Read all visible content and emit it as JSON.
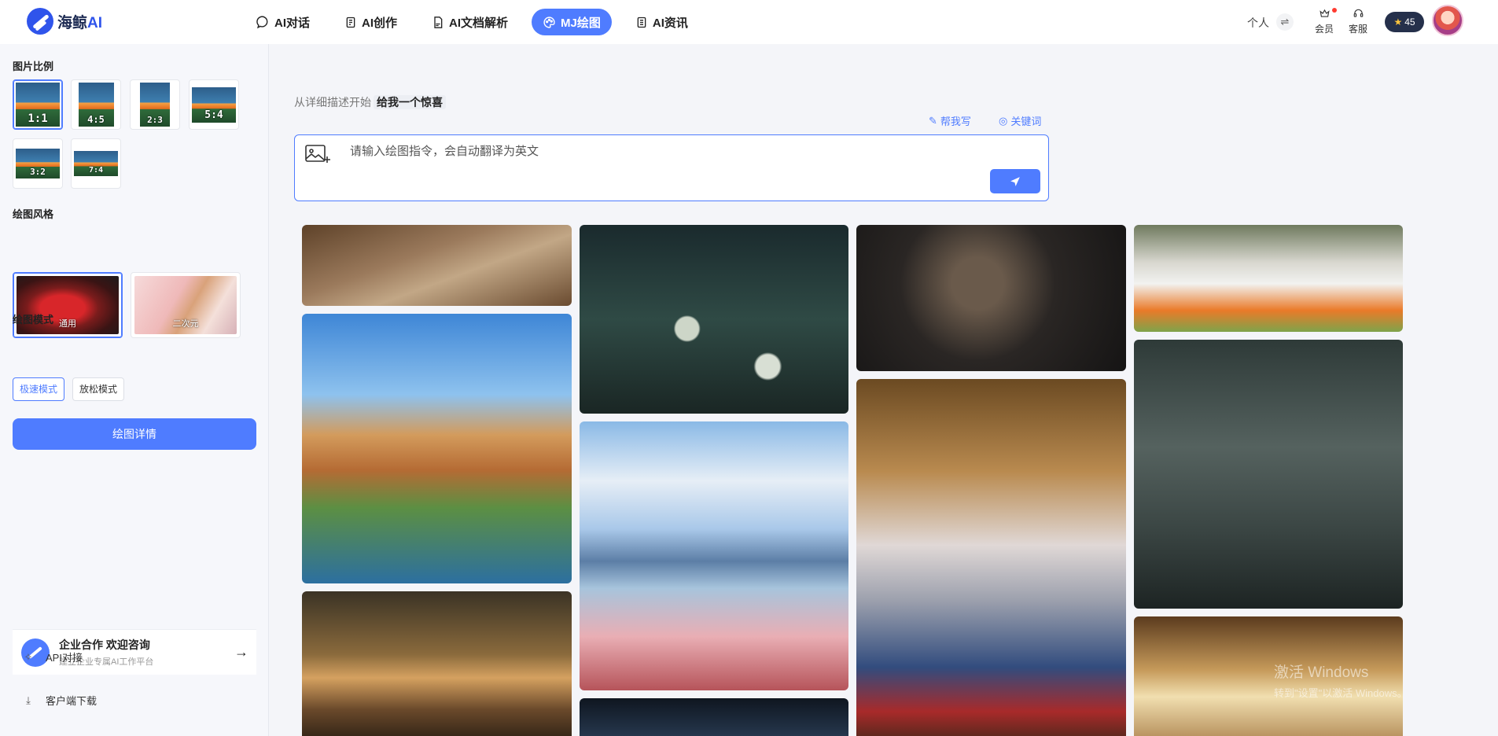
{
  "header": {
    "logo_cn": "海鲸",
    "logo_ai": "AI",
    "nav": [
      {
        "label": "AI对话",
        "icon": "chat-bubble-icon"
      },
      {
        "label": "AI创作",
        "icon": "notebook-icon"
      },
      {
        "label": "AI文档解析",
        "icon": "pdf-file-icon"
      },
      {
        "label": "MJ绘图",
        "icon": "palette-icon",
        "active": true
      },
      {
        "label": "AI资讯",
        "icon": "news-icon"
      }
    ],
    "personal": "个人",
    "swap_symbol": "⇌",
    "vip_label": "会员",
    "service_label": "客服",
    "points": "45"
  },
  "sidebar": {
    "ratio_title": "图片比例",
    "ratios": [
      "1:1",
      "4:5",
      "2:3",
      "5:4",
      "3:2",
      "7:4"
    ],
    "ratio_selected": "1:1",
    "style_title": "绘图风格",
    "styles": [
      "通用",
      "二次元"
    ],
    "style_selected": "通用",
    "mode_title": "绘图模式",
    "modes": [
      "极速模式",
      "放松模式"
    ],
    "mode_selected": "极速模式",
    "detail_button": "绘图详情",
    "enterprise_title": "企业合作 欢迎咨询",
    "enterprise_sub": "建立企业专属AI工作平台",
    "api_link": "API对接",
    "download_link": "客户端下载"
  },
  "main": {
    "hint_prefix": "从详细描述开始",
    "hint_action": "给我一个惊喜",
    "help_write": "帮我写",
    "keywords": "关键词",
    "prompt_placeholder": "请输入绘图指令，会自动翻译为英文"
  },
  "watermark": {
    "line1": "激活 Windows",
    "line2": "转到\"设置\"以激活 Windows。"
  },
  "colors": {
    "accent": "#4f7cff",
    "points_bg": "#25304b",
    "sidebar_bg": "#f6f7fb",
    "page_bg": "#f4f5f9"
  }
}
